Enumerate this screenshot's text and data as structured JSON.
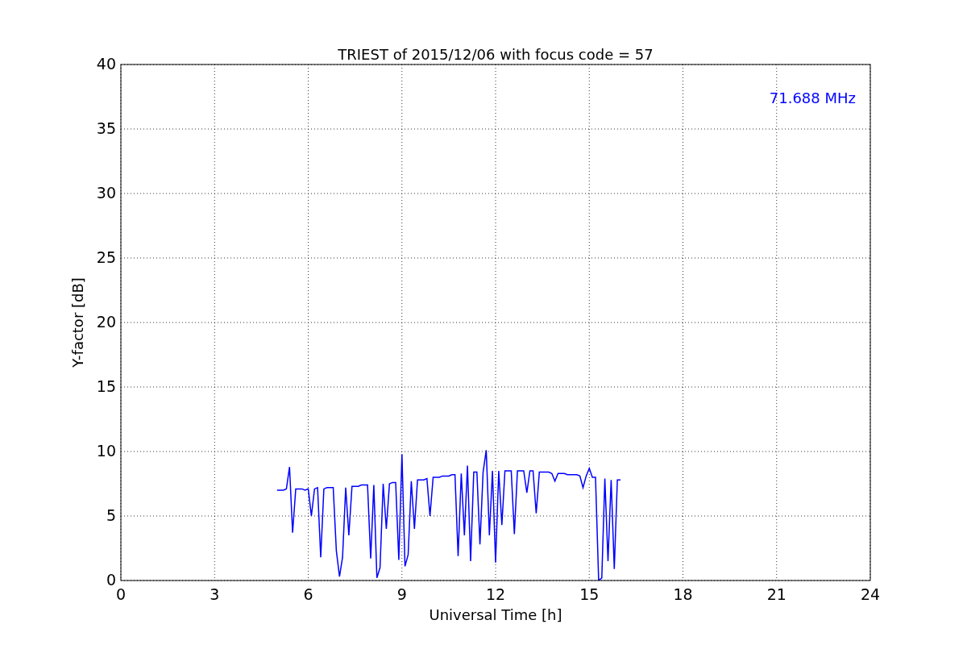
{
  "chart_data": {
    "type": "line",
    "title": "TRIEST of 2015/12/06 with focus code = 57",
    "xlabel": "Universal Time [h]",
    "ylabel": "Y-factor [dB]",
    "xlim": [
      0,
      24
    ],
    "ylim": [
      0,
      40
    ],
    "xticks": [
      0,
      3,
      6,
      9,
      12,
      15,
      18,
      21,
      24
    ],
    "yticks": [
      0,
      5,
      10,
      15,
      20,
      25,
      30,
      35,
      40
    ],
    "x": [
      5.0,
      5.1,
      5.2,
      5.3,
      5.4,
      5.5,
      5.6,
      5.7,
      5.8,
      5.9,
      6.0,
      6.1,
      6.2,
      6.3,
      6.4,
      6.5,
      6.6,
      6.7,
      6.8,
      6.9,
      7.0,
      7.1,
      7.2,
      7.3,
      7.4,
      7.5,
      7.6,
      7.7,
      7.8,
      7.9,
      8.0,
      8.1,
      8.2,
      8.3,
      8.4,
      8.5,
      8.6,
      8.7,
      8.8,
      8.9,
      9.0,
      9.1,
      9.2,
      9.3,
      9.4,
      9.5,
      9.6,
      9.7,
      9.8,
      9.9,
      10.0,
      10.1,
      10.2,
      10.3,
      10.4,
      10.5,
      10.6,
      10.7,
      10.8,
      10.9,
      11.0,
      11.1,
      11.2,
      11.3,
      11.4,
      11.5,
      11.6,
      11.7,
      11.8,
      11.9,
      12.0,
      12.1,
      12.2,
      12.3,
      12.4,
      12.5,
      12.6,
      12.7,
      12.8,
      12.9,
      13.0,
      13.1,
      13.2,
      13.3,
      13.4,
      13.5,
      13.6,
      13.7,
      13.8,
      13.9,
      14.0,
      14.1,
      14.2,
      14.3,
      14.4,
      14.5,
      14.6,
      14.7,
      14.8,
      14.9,
      15.0,
      15.1,
      15.2,
      15.3,
      15.4,
      15.5,
      15.6,
      15.7,
      15.8,
      15.9,
      16.0
    ],
    "series": [
      {
        "name": "71.688 MHz",
        "color": "#0000ff",
        "values": [
          7.0,
          7.0,
          7.0,
          7.1,
          8.8,
          3.7,
          7.1,
          7.1,
          7.1,
          7.0,
          7.1,
          5.0,
          7.1,
          7.2,
          1.8,
          7.1,
          7.2,
          7.2,
          7.2,
          2.3,
          0.3,
          1.8,
          7.2,
          3.5,
          7.3,
          7.3,
          7.3,
          7.4,
          7.4,
          7.4,
          1.7,
          7.4,
          0.2,
          1.0,
          7.5,
          4.0,
          7.5,
          7.6,
          7.6,
          1.6,
          9.8,
          1.1,
          2.0,
          7.7,
          4.0,
          7.8,
          7.8,
          7.8,
          7.9,
          5.0,
          8.0,
          8.0,
          8.0,
          8.1,
          8.1,
          8.1,
          8.2,
          8.2,
          1.9,
          8.3,
          3.5,
          8.9,
          1.5,
          8.4,
          8.4,
          2.8,
          8.4,
          10.1,
          3.5,
          8.5,
          1.4,
          8.5,
          4.3,
          8.5,
          8.5,
          8.5,
          3.6,
          8.5,
          8.5,
          8.5,
          6.8,
          8.5,
          8.5,
          5.2,
          8.4,
          8.4,
          8.4,
          8.4,
          8.3,
          7.7,
          8.3,
          8.3,
          8.3,
          8.2,
          8.2,
          8.2,
          8.2,
          8.1,
          7.2,
          8.1,
          8.7,
          8.0,
          8.0,
          0.0,
          0.2,
          7.9,
          1.5,
          7.8,
          0.9,
          7.8,
          7.8
        ]
      }
    ],
    "grid": true
  }
}
